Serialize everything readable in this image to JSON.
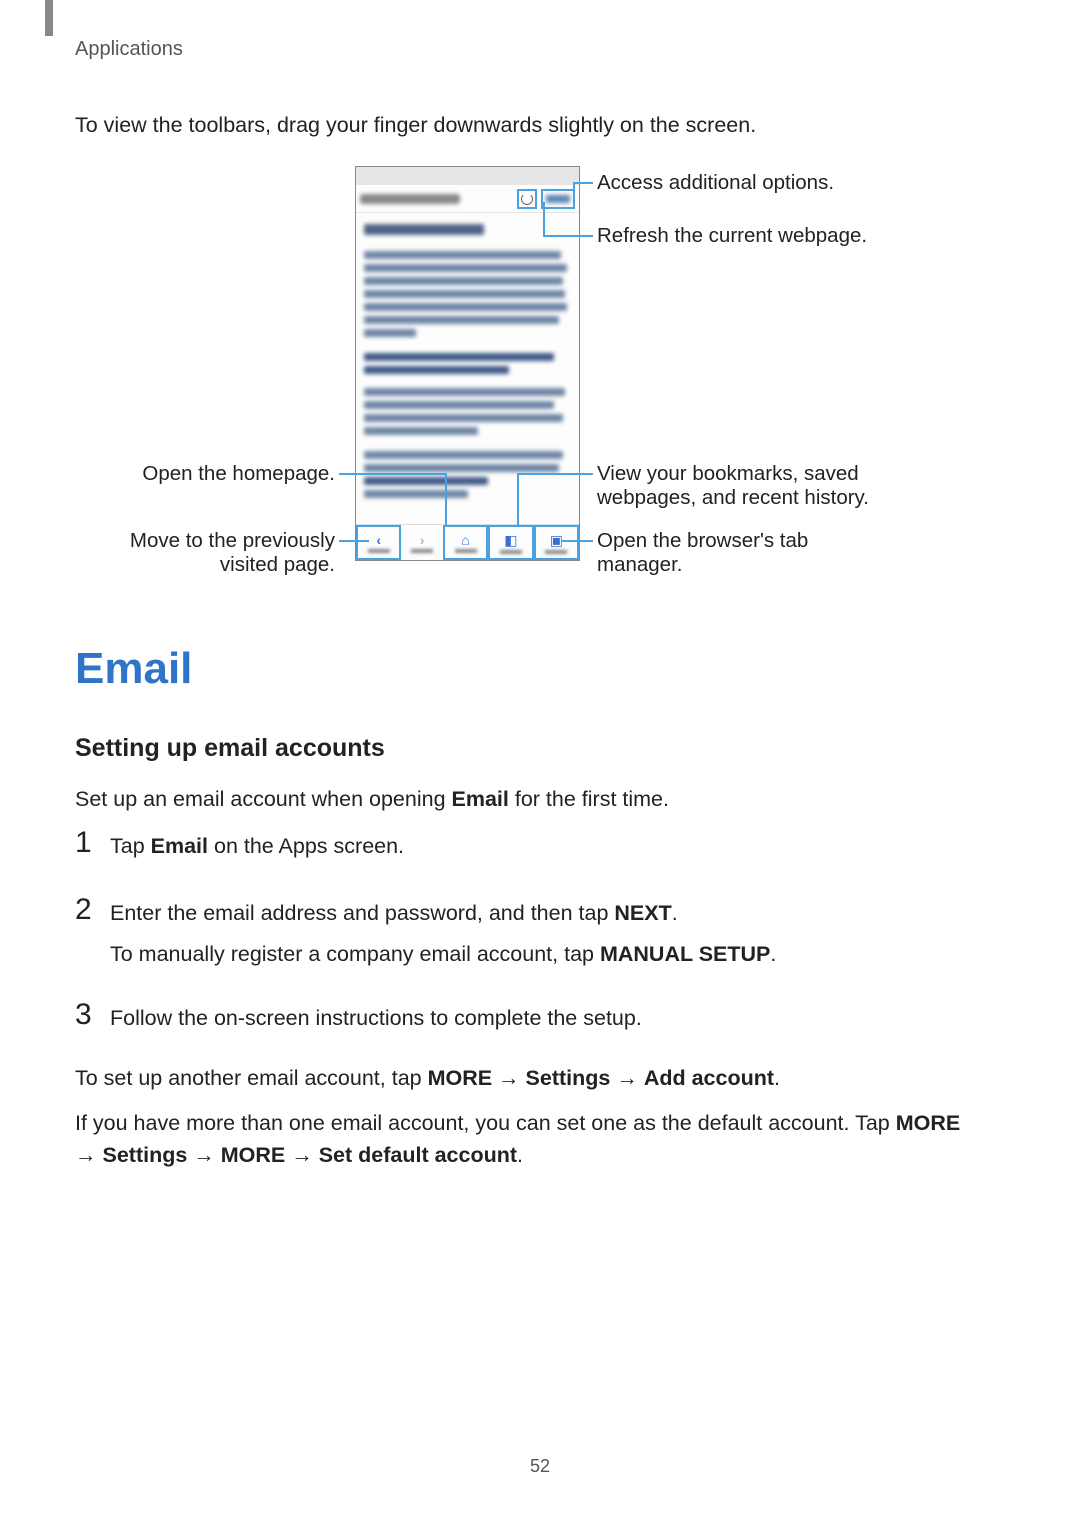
{
  "header": {
    "section": "Applications"
  },
  "intro": "To view the toolbars, drag your finger downwards slightly on the screen.",
  "diagram": {
    "leftLabels": {
      "homepage": "Open the homepage.",
      "back": "Move to the previously visited page."
    },
    "rightLabels": {
      "more": "Access additional options.",
      "refresh": "Refresh the current webpage.",
      "bookmarks": "View your bookmarks, saved webpages, and recent history.",
      "tabs": "Open the browser's tab manager."
    }
  },
  "h1": "Email",
  "h2": "Setting up email accounts",
  "p1_a": "Set up an email account when opening ",
  "p1_b": "Email",
  "p1_c": " for the first time.",
  "steps": {
    "s1": {
      "num": "1",
      "a": "Tap ",
      "b": "Email",
      "c": " on the Apps screen."
    },
    "s2": {
      "num": "2",
      "line1a": "Enter the email address and password, and then tap ",
      "line1b": "NEXT",
      "line1c": ".",
      "line2a": "To manually register a company email account, tap ",
      "line2b": "MANUAL SETUP",
      "line2c": "."
    },
    "s3": {
      "num": "3",
      "text": "Follow the on-screen instructions to complete the setup."
    }
  },
  "p2": {
    "a": "To set up another email account, tap ",
    "b": "MORE",
    "arrow": " → ",
    "c": "Settings",
    "d": "Add account",
    "end": "."
  },
  "p3": {
    "a": "If you have more than one email account, you can set one as the default account. Tap ",
    "b": "MORE",
    "arrow": " → ",
    "c": "Settings",
    "d": "MORE",
    "e": "Set default account",
    "end": "."
  },
  "pageNumber": "52"
}
